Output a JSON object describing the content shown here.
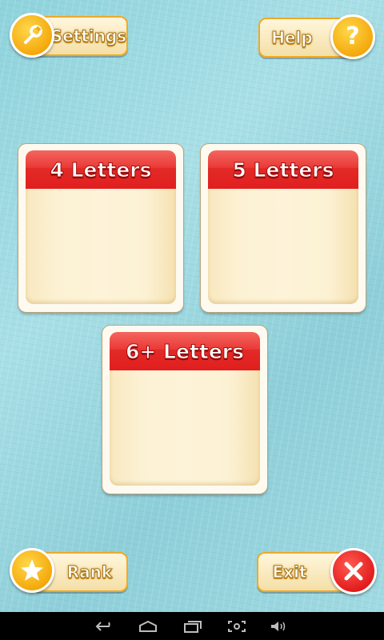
{
  "top_bar": {
    "settings_label": "Settings",
    "help_label": "Help",
    "settings_icon": "wrench-icon",
    "help_icon": "question-icon"
  },
  "modes": [
    {
      "label": "4 Letters"
    },
    {
      "label": "5 Letters"
    },
    {
      "label": "6+ Letters"
    }
  ],
  "bottom_bar": {
    "rank_label": "Rank",
    "exit_label": "Exit",
    "rank_icon": "star-icon",
    "exit_icon": "x-icon"
  },
  "system_nav": {
    "icons": [
      "back-icon",
      "home-icon",
      "recent-apps-icon",
      "screenshot-icon",
      "volume-icon"
    ]
  },
  "colors": {
    "background": "#9dd9e1",
    "accent_gold": "#f5a90c",
    "card_header_red": "#e32a27",
    "exit_red": "#e21d1d",
    "card_body": "#fcf1d3"
  }
}
